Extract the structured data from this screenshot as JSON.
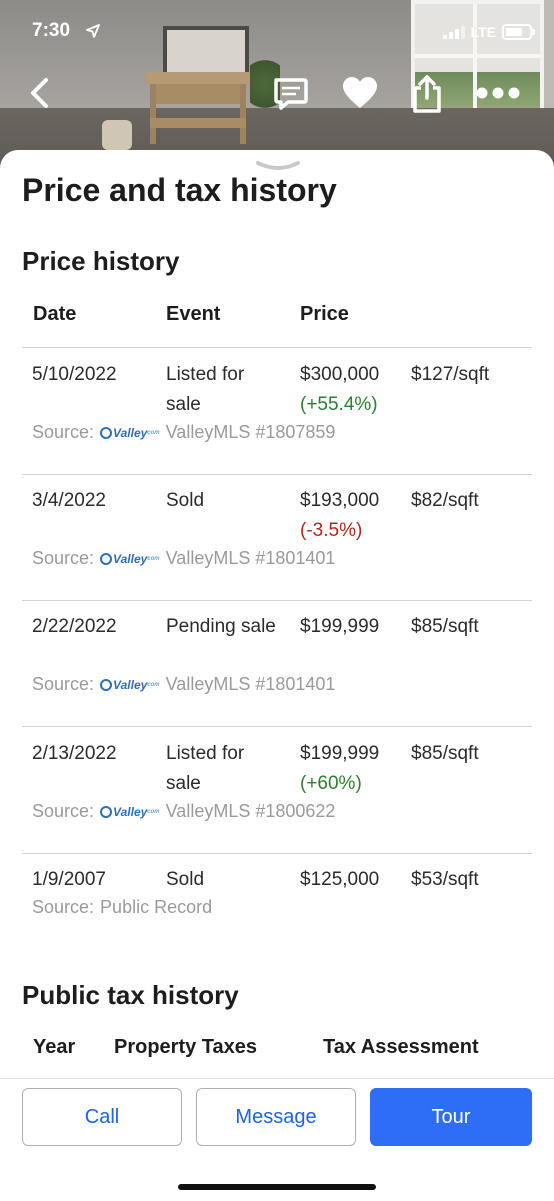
{
  "status_bar": {
    "time": "7:30",
    "network": "LTE"
  },
  "nav": {
    "back_icon": "chevron-left-icon",
    "chat_icon": "chat-bubble-icon",
    "favorite_icon": "heart-icon",
    "share_icon": "share-icon",
    "more_icon": "more-dots-icon"
  },
  "page_title": "Price and tax history",
  "price_history": {
    "title": "Price history",
    "columns": {
      "date": "Date",
      "event": "Event",
      "price": "Price"
    },
    "rows": [
      {
        "date": "5/10/2022",
        "event": "Listed for sale",
        "price": "$300,000",
        "change": "(+55.4%)",
        "change_dir": "up",
        "per_sqft": "$127/sqft",
        "source_label": "Source:",
        "source": "ValleyMLS #1807859",
        "has_logo": true
      },
      {
        "date": "3/4/2022",
        "event": "Sold",
        "price": "$193,000",
        "change": "(-3.5%)",
        "change_dir": "down",
        "per_sqft": "$82/sqft",
        "source_label": "Source:",
        "source": "ValleyMLS #1801401",
        "has_logo": true
      },
      {
        "date": "2/22/2022",
        "event": "Pending sale",
        "price": "$199,999",
        "change": "",
        "change_dir": "",
        "per_sqft": "$85/sqft",
        "source_label": "Source:",
        "source": "ValleyMLS #1801401",
        "has_logo": true
      },
      {
        "date": "2/13/2022",
        "event": "Listed for sale",
        "price": "$199,999",
        "change": "(+60%)",
        "change_dir": "up",
        "per_sqft": "$85/sqft",
        "source_label": "Source:",
        "source": "ValleyMLS #1800622",
        "has_logo": true
      },
      {
        "date": "1/9/2007",
        "event": "Sold",
        "price": "$125,000",
        "change": "",
        "change_dir": "",
        "per_sqft": "$53/sqft",
        "source_label": "Source:",
        "source": "Public Record",
        "has_logo": false
      }
    ],
    "mls_logo_text": "Valley",
    "mls_logo_suffix": "com"
  },
  "tax_history": {
    "title": "Public tax history",
    "columns": {
      "year": "Year",
      "taxes": "Property Taxes",
      "assessment": "Tax Assessment"
    }
  },
  "actions": {
    "call": "Call",
    "message": "Message",
    "tour": "Tour"
  },
  "colors": {
    "primary": "#2e6df6",
    "link": "#1f62e6",
    "up": "#2e7d32",
    "down": "#b3261e"
  }
}
